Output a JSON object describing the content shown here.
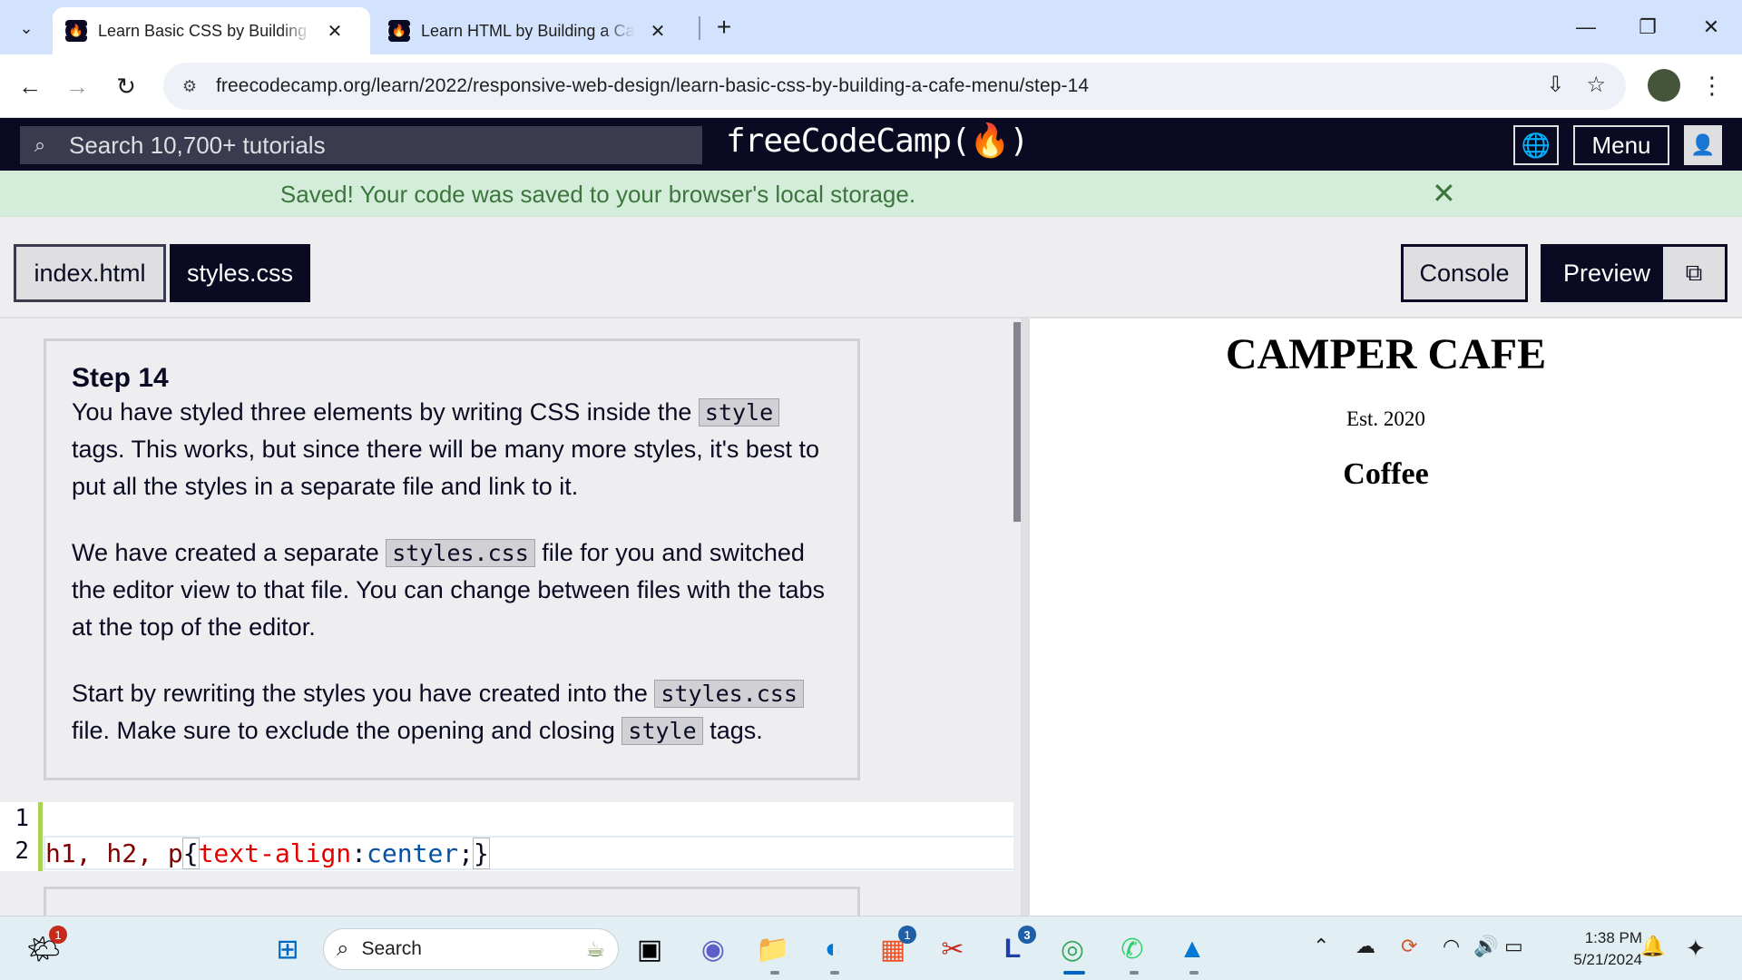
{
  "browser": {
    "tabs": [
      {
        "title": "Learn Basic CSS by Building a Cafe Menu",
        "active": true
      },
      {
        "title": "Learn HTML by Building a Cat Photo App",
        "active": false
      }
    ],
    "url": "freecodecamp.org/learn/2022/responsive-web-design/learn-basic-css-by-building-a-cafe-menu/step-14"
  },
  "nav": {
    "search_placeholder": "Search 10,700+ tutorials",
    "logo": "freeCodeCamp(🔥)",
    "menu_label": "Menu"
  },
  "flash": {
    "message": "Saved! Your code was saved to your browser's local storage.",
    "close": "✕"
  },
  "editor": {
    "file_tabs": [
      "index.html",
      "styles.css"
    ],
    "active_file": "styles.css",
    "console_label": "Console",
    "preview_label": "Preview"
  },
  "instructions": {
    "step_title": "Step 14",
    "p1_a": "You have styled three elements by writing CSS inside the",
    "p1_code": "style",
    "p1_b": "tags. This works, but since there will be many more styles, it's best to put all the styles in a separate file and link to it.",
    "p2_a": "We have created a separate",
    "p2_code": "styles.css",
    "p2_b": "file for you and switched the editor view to that file. You can change between files with the tabs at the top of the editor.",
    "p3_a": "Start by rewriting the styles you have created into the",
    "p3_code": "styles.css",
    "p3_b": "file. Make sure to exclude the opening and closing",
    "p3_code2": "style",
    "p3_c": "tags."
  },
  "code": {
    "line_numbers": [
      "1",
      "2"
    ],
    "line2": {
      "selector": "h1, h2, p",
      "open": "{",
      "property": "text-align",
      "colon": ":",
      "value": "center",
      "semi": ";",
      "close": "}"
    }
  },
  "preview": {
    "h1": "CAMPER CAFE",
    "p": "Est. 2020",
    "h2": "Coffee"
  },
  "taskbar": {
    "search_label": "Search",
    "time": "1:38 PM",
    "date": "5/21/2024",
    "badges": {
      "weather": "1",
      "store": "1",
      "launcher": "3"
    }
  },
  "colors": {
    "fcc_dark": "#0a0a23",
    "flash_bg": "#d4edda",
    "flash_text": "#3c763d",
    "selector": "#800000",
    "property": "#e50000",
    "value": "#0451a5"
  }
}
